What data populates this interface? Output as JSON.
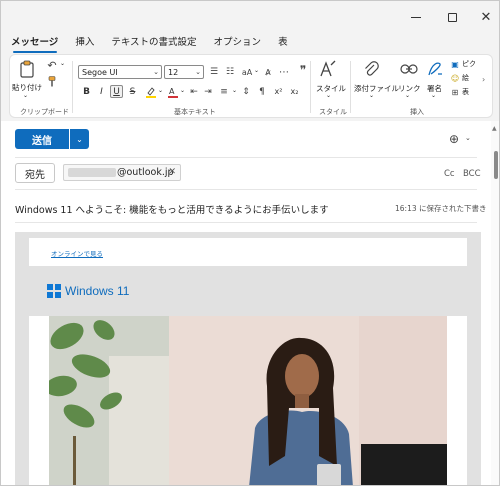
{
  "window": {
    "controls": {
      "minimize": "—",
      "maximize": "□",
      "close": "✕"
    }
  },
  "tabs": [
    {
      "label": "メッセージ",
      "active": true
    },
    {
      "label": "挿入",
      "active": false
    },
    {
      "label": "テキストの書式設定",
      "active": false
    },
    {
      "label": "オプション",
      "active": false
    },
    {
      "label": "表",
      "active": false
    }
  ],
  "ribbon": {
    "clipboard": {
      "paste_label": "貼り付け",
      "group_label": "クリップボード"
    },
    "font": {
      "font_name": "Segoe UI",
      "font_size": "12"
    },
    "basic_text": {
      "group_label": "基本テキスト",
      "bold": "B",
      "italic": "I",
      "underline": "U",
      "strike": "S",
      "superscript": "x²",
      "subscript": "x₂"
    },
    "style": {
      "label": "スタイル",
      "group_label": "スタイル"
    },
    "insert": {
      "attach_label": "添付ファイル",
      "link_label": "リンク",
      "signature_label": "署名",
      "group_label": "挿入",
      "overflow_1": "ピク",
      "overflow_2": "絵",
      "overflow_3": "表"
    }
  },
  "compose": {
    "send_label": "送信",
    "to_label": "宛先",
    "recipient_suffix": "@outlook.jp",
    "cc_label": "Cc",
    "bcc_label": "BCC",
    "subject": "Windows 11 へようこそ: 機能をもっと活用できるようにお手伝いします",
    "saved_status": "16:13 に保存された下書き"
  },
  "email_body": {
    "online_link": "オンラインで見る",
    "logo_text": "Windows 11"
  },
  "colors": {
    "accent": "#0f6cbd",
    "logo_blue": "#0f78d4",
    "window_bg": "#f3f3f3"
  }
}
